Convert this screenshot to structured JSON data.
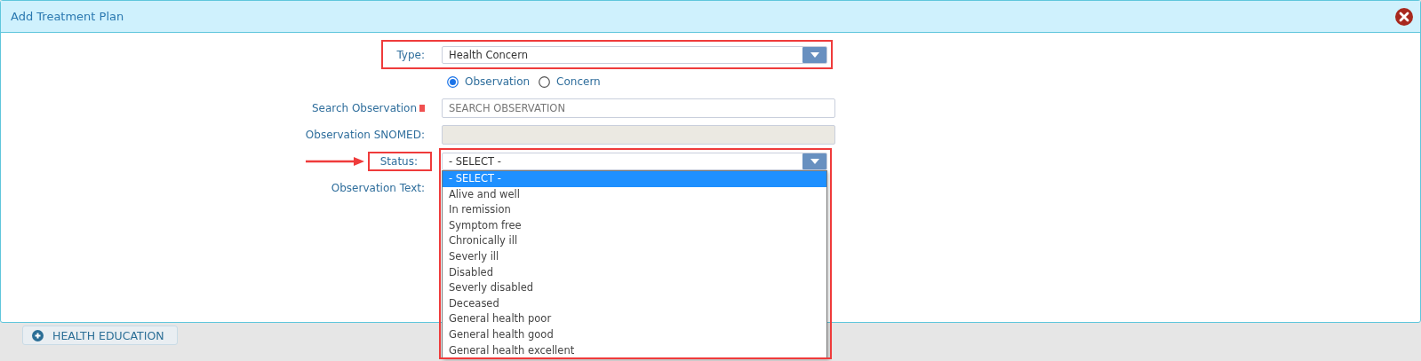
{
  "dialog": {
    "title": "Add Treatment Plan"
  },
  "form": {
    "type": {
      "label": "Type:",
      "value": "Health Concern",
      "highlighted": true
    },
    "mode_options": [
      {
        "label": "Observation",
        "selected": true
      },
      {
        "label": "Concern",
        "selected": false
      }
    ],
    "search": {
      "label": "Search Observation",
      "required": true,
      "placeholder": "SEARCH OBSERVATION"
    },
    "snomed": {
      "label": "Observation SNOMED:",
      "disabled": true
    },
    "status": {
      "label": "Status:",
      "value": "- SELECT -",
      "label_highlighted": true,
      "field_highlighted": true,
      "pointer_arrow": true,
      "expanded": true,
      "options": [
        {
          "label": "- SELECT -",
          "selected": true
        },
        {
          "label": "Alive and well",
          "selected": false
        },
        {
          "label": "In remission",
          "selected": false
        },
        {
          "label": "Symptom free",
          "selected": false
        },
        {
          "label": "Chronically ill",
          "selected": false
        },
        {
          "label": "Severly ill",
          "selected": false
        },
        {
          "label": "Disabled",
          "selected": false
        },
        {
          "label": "Severly disabled",
          "selected": false
        },
        {
          "label": "Deceased",
          "selected": false
        },
        {
          "label": "General health poor",
          "selected": false
        },
        {
          "label": "General health good",
          "selected": false
        },
        {
          "label": "General health excellent",
          "selected": false
        }
      ]
    },
    "observation_text": {
      "label": "Observation Text:"
    }
  },
  "sections": [
    {
      "label": "HEALTH EDUCATION"
    }
  ]
}
